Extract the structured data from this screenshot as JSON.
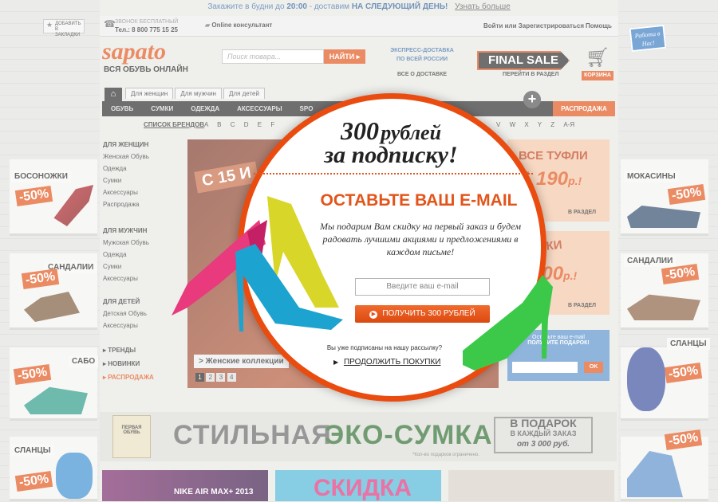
{
  "top_banner": {
    "text_a": "Закажите в будни до",
    "time": "20:00",
    "text_b": "- доставим",
    "bold": "НА СЛЕДУЮЩИЙ ДЕНЬ!",
    "link": "Узнать больше"
  },
  "header": {
    "bookmark": "ДОБАВИТЬ В ЗАКЛАДКИ",
    "phone_label": "ЗВОНОК БЕСПЛАТНЫЙ",
    "phone": "Тел.: 8 800 775 15 25",
    "consultant": "Online консультант",
    "login": "Войти или Зарегистрироваться",
    "help": "Помощь",
    "logo": "sapato",
    "logo_sub": "ВСЯ ОБУВЬ ОНЛАЙН",
    "search_placeholder": "Поиск товара...",
    "search_button": "НАЙТИ",
    "express_1": "ЭКСПРЕСС-ДОСТАВКА",
    "express_2": "ПО ВСЕЙ РОССИИ",
    "express_link": "ВСЕ О ДОСТАВКЕ",
    "final_sale": "FINAL SALE",
    "final_sale_link": "ПЕРЕЙТИ В РАЗДЕЛ",
    "cart": "КОРЗИНА",
    "hiring": "Работа в Нас!"
  },
  "tabs": [
    "Для женщин",
    "Для мужчин",
    "Для детей"
  ],
  "nav": [
    "ОБУВЬ",
    "СУМКИ",
    "ОДЕЖДА",
    "АКСЕССУАРЫ",
    "SPO"
  ],
  "nav_sale": "РАСПРОДАЖА",
  "brands": {
    "label": "СПИСОК БРЕНДОВ",
    "left": [
      "A",
      "B",
      "C",
      "D",
      "E",
      "F"
    ],
    "right": [
      "V",
      "W",
      "X",
      "Y",
      "Z",
      "А-Я"
    ]
  },
  "leftnav": {
    "women_h": "ДЛЯ ЖЕНЩИН",
    "women": [
      "Женская Обувь",
      "Одежда",
      "Сумки",
      "Аксессуары",
      "Распродажа"
    ],
    "men_h": "ДЛЯ МУЖЧИН",
    "men": [
      "Мужская Обувь",
      "Одежда",
      "Сумки",
      "Аксессуары"
    ],
    "kids_h": "ДЛЯ ДЕТЕЙ",
    "kids": [
      "Детская Обувь",
      "Аксессуары"
    ],
    "extra": [
      "ТРЕНДЫ",
      "НОВИНКИ",
      "РАСПРОДАЖА"
    ]
  },
  "slider": {
    "text": "С 15 И",
    "caption": "> Женские коллекции",
    "pages": [
      "1",
      "2",
      "3",
      "4"
    ]
  },
  "right_promos": {
    "shoes_title": "ВСЕ ТУФЛИ",
    "shoes_price": "1 190",
    "ballet": "АЛЕТКИ",
    "ballet_price": "000",
    "currency": "р.!",
    "link": "В РАЗДЕЛ",
    "subscribe_1": "Оставьте ваш e-mail",
    "subscribe_2": "ПОЛУЧИТЕ ПОДАРОК!",
    "ok": "OK"
  },
  "side_left": [
    {
      "label": "БОСОНОЖКИ",
      "pct": "-50%"
    },
    {
      "label": "САНДАЛИИ",
      "pct": "-50%"
    },
    {
      "label": "САБО",
      "pct": "-50%"
    },
    {
      "label": "СЛАНЦЫ",
      "pct": "-50%"
    }
  ],
  "side_right": [
    {
      "label": "МОКАСИНЫ",
      "pct": "-50%"
    },
    {
      "label": "САНДАЛИИ",
      "pct": "-50%"
    },
    {
      "label": "СЛАНЦЫ",
      "pct": "-50%"
    },
    {
      "label": "",
      "pct": "-50%"
    }
  ],
  "eco": {
    "w1": "СТИЛЬНАЯ",
    "w2": "ЭКО-СУМКА",
    "gift_1": "В ПОДАРОК",
    "gift_2": "В КАЖДЫЙ ЗАКАЗ",
    "gift_3": "от 3 000 руб.",
    "note": "*Кол-во подарков ограничено.",
    "bag": "ПЕРВАЯ ОБУВЬ"
  },
  "bottom": {
    "nike": "NIKE AIR MAX+ 2013",
    "skidka": "СКИДКА"
  },
  "popup": {
    "title_1": "300",
    "title_1b": "рублей",
    "title_2": "за подписку!",
    "heading": "ОСТАВЬТЕ ВАШ E-MAIL",
    "body": "Мы подарим Вам скидку на первый заказ и будем радовать лучшими акциями и предложениями в каждом письме!",
    "email_placeholder": "Введите ваш e-mail",
    "button": "ПОЛУЧИТЬ 300 РУБЛЕЙ",
    "already": "Вы уже подписаны на нашу рассылку?",
    "continue": "ПРОДОЛЖИТЬ ПОКУПКИ"
  },
  "colors": {
    "accent": "#e2541a",
    "popup_border": "#ea4c10",
    "popup_heading": "#e2541a"
  }
}
